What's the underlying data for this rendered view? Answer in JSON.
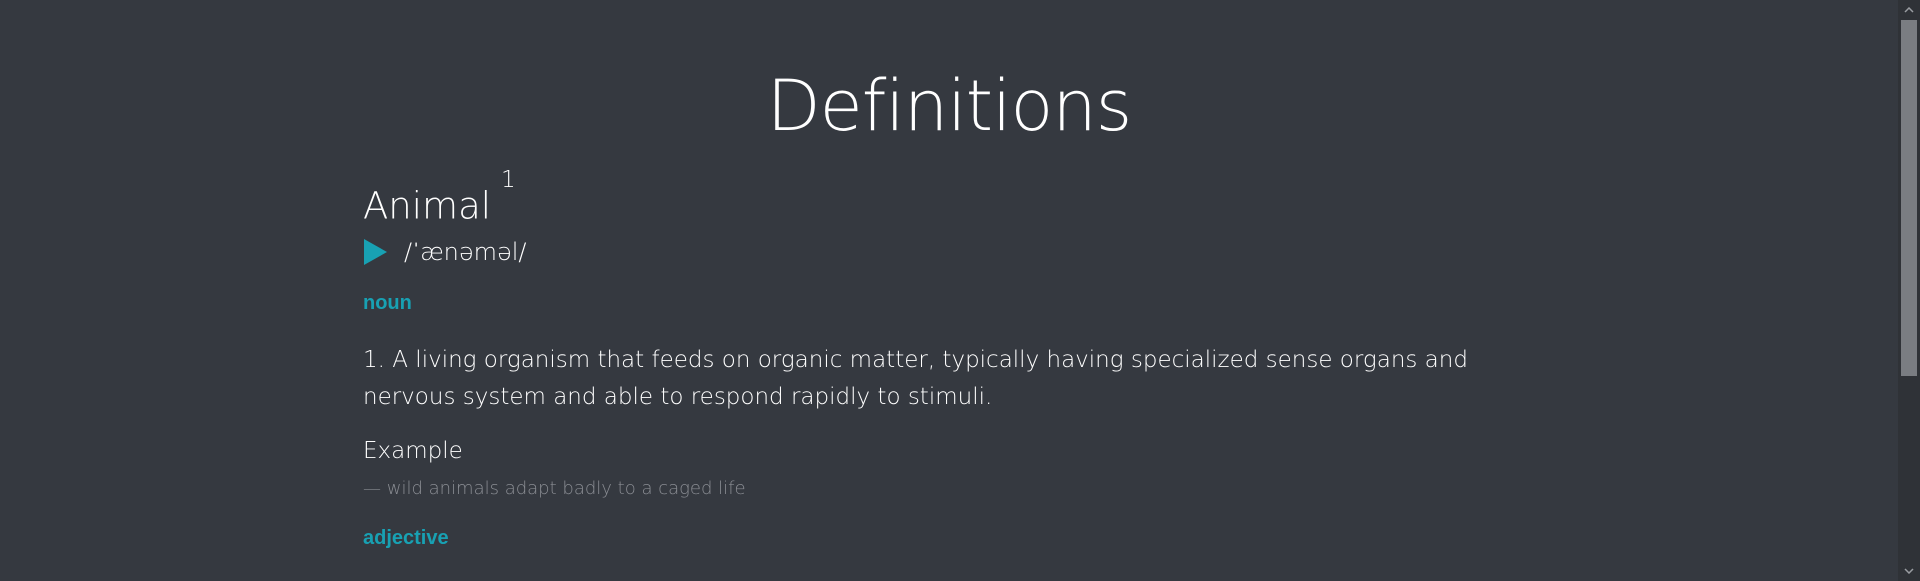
{
  "page": {
    "title": "Definitions"
  },
  "entry": {
    "word": "Animal",
    "homograph_number": "1",
    "phonetic": "/ˈænəməl/",
    "audio_icon": "play-icon",
    "accent_color": "#18a1b3"
  },
  "meanings": [
    {
      "part_of_speech": "noun",
      "definitions": [
        {
          "text": "1. A living organism that feeds on organic matter, typically having specialized sense organs and nervous system and able to respond rapidly to stimuli.",
          "example_label": "Example",
          "example": "— wild animals adapt badly to a caged life"
        }
      ]
    },
    {
      "part_of_speech": "adjective"
    }
  ],
  "scrollbar": {
    "up_icon": "chevron-up-icon",
    "down_icon": "chevron-down-icon"
  }
}
